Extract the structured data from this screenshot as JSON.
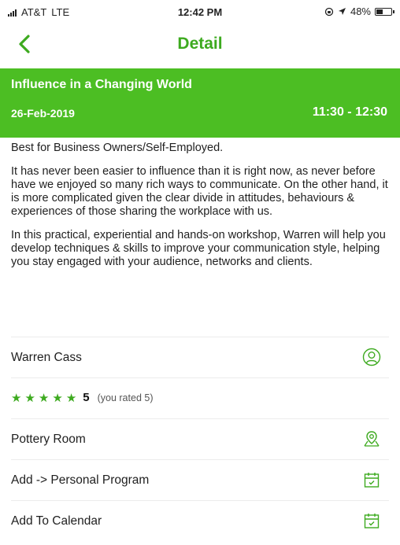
{
  "status_bar": {
    "carrier": "AT&T",
    "network": "LTE",
    "time": "12:42 PM",
    "battery_text": "48%",
    "battery_level": 0.48
  },
  "nav": {
    "title": "Detail",
    "back_icon": "chevron-left-icon"
  },
  "event": {
    "title": "Influence in a Changing World",
    "date": "26-Feb-2019",
    "time_range": "11:30 - 12:30"
  },
  "description": {
    "audience": "Best for Business Owners/Self-Employed.",
    "paragraph_1": "It has never been easier to influence than it is right now, as never before have we enjoyed so many rich ways to communicate. On the other hand, it is more complicated given the clear divide in attitudes, behaviours & experiences of those sharing the workplace with us.",
    "paragraph_2": "In this practical, experiential and hands-on workshop, Warren will help you develop techniques & skills to improve your communication style, helping you stay engaged with your audience, networks and clients."
  },
  "details": {
    "speaker": {
      "label": "Warren Cass",
      "icon": "person-icon"
    },
    "rating": {
      "stars": 5,
      "value": "5",
      "note": "(you rated 5)"
    },
    "location": {
      "label": "Pottery Room",
      "icon": "map-pin-icon"
    },
    "add_program": {
      "label": "Add -> Personal Program",
      "icon": "calendar-check-icon"
    },
    "add_calendar": {
      "label": "Add To Calendar",
      "icon": "calendar-check-icon"
    }
  },
  "colors": {
    "accent": "#3daa1f",
    "banner": "#4cbe23"
  }
}
